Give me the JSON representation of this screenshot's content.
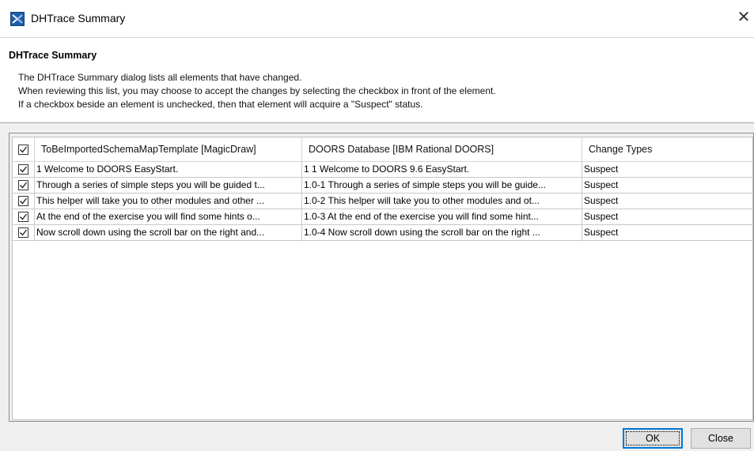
{
  "window": {
    "title": "DHTrace Summary",
    "close_glyph": "✕"
  },
  "description": {
    "heading": "DHTrace Summary",
    "lines": [
      "The DHTrace Summary dialog lists all elements that have changed.",
      "When reviewing this list, you may choose to accept the changes by selecting the checkbox in front of the element.",
      "If a checkbox beside an element is unchecked, then that element will acquire a \"Suspect\" status."
    ]
  },
  "table": {
    "select_all_checked": true,
    "columns": [
      "ToBeImportedSchemaMapTemplate [MagicDraw]",
      "DOORS Database [IBM Rational DOORS]",
      "Change Types"
    ],
    "rows": [
      {
        "checked": true,
        "source": "1 Welcome to DOORS EasyStart.",
        "target": "1 1 Welcome to DOORS 9.6 EasyStart.",
        "change": "Suspect"
      },
      {
        "checked": true,
        "source": "Through a series of simple steps you will be guided t...",
        "target": "1.0-1 Through a series of simple steps you will be guide...",
        "change": "Suspect"
      },
      {
        "checked": true,
        "source": "This helper will take you to other modules and other ...",
        "target": "1.0-2 This helper will take you to other modules and ot...",
        "change": "Suspect"
      },
      {
        "checked": true,
        "source": "At the end of the exercise you will find some hints o...",
        "target": "1.0-3 At the end of the exercise you will find some hint...",
        "change": "Suspect"
      },
      {
        "checked": true,
        "source": "Now scroll down using the scroll bar on the right and...",
        "target": "1.0-4 Now scroll down using the scroll bar on the right ...",
        "change": "Suspect"
      }
    ]
  },
  "buttons": {
    "ok": "OK",
    "close": "Close"
  },
  "colors": {
    "accent": "#0078d7",
    "icon_blue": "#1f5fa8"
  }
}
